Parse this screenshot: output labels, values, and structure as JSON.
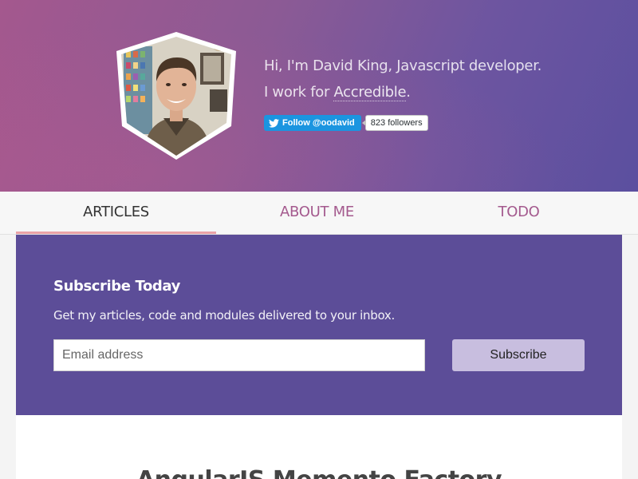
{
  "hero": {
    "intro_line1": "Hi, I'm David King, Javascript developer.",
    "intro_line2_prefix": "I work for ",
    "employer_link": "Accredible",
    "intro_line2_suffix": "."
  },
  "twitter": {
    "follow_label": "Follow @oodavid",
    "followers": "823 followers",
    "brand_color": "#1b95e0"
  },
  "nav": {
    "items": [
      {
        "label": "ARTICLES",
        "active": true
      },
      {
        "label": "ABOUT ME",
        "active": false
      },
      {
        "label": "TODO",
        "active": false
      }
    ]
  },
  "subscribe": {
    "title": "Subscribe Today",
    "description": "Get my articles, code and modules delivered to your inbox.",
    "email_placeholder": "Email address",
    "button_label": "Subscribe",
    "background": "#5c4d98"
  },
  "article": {
    "title": "AngularJS Memento Factory"
  },
  "colors": {
    "accent": "#a45a8e",
    "active_tab_underline": "#eba3a7"
  }
}
